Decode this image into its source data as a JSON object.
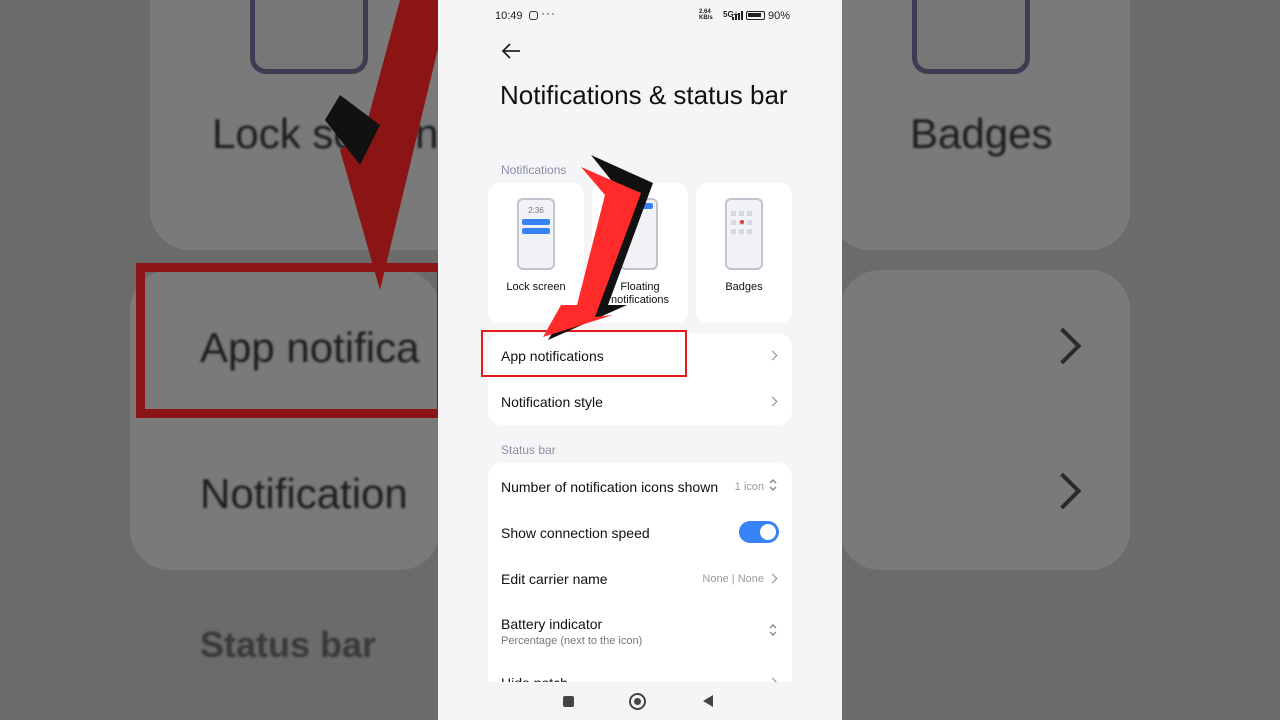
{
  "background": {
    "lock_screen": "Lock screen",
    "badges": "Badges",
    "app_notifications": "App notifica",
    "notification": "Notification",
    "status_bar": "Status bar"
  },
  "statusbar": {
    "time": "10:49",
    "speed_value": "2.64",
    "speed_unit": "KB/s",
    "network": "5G+",
    "battery": "90%"
  },
  "page": {
    "title": "Notifications & status bar",
    "section_notifications": "Notifications",
    "section_status_bar": "Status bar"
  },
  "tiles": [
    {
      "label": "Lock screen",
      "time": "2:36"
    },
    {
      "label": "Floating notifications"
    },
    {
      "label": "Badges"
    }
  ],
  "notification_rows": {
    "app_notifications": "App notifications",
    "notification_style": "Notification style"
  },
  "status_rows": {
    "icons_shown_label": "Number of notification icons shown",
    "icons_shown_value": "1 icon",
    "connection_speed_label": "Show connection speed",
    "connection_speed_on": true,
    "carrier_label": "Edit carrier name",
    "carrier_value": "None | None",
    "battery_label": "Battery indicator",
    "battery_sub": "Percentage (next to the icon)",
    "hide_notch_label": "Hide notch"
  },
  "colors": {
    "accent": "#3a82f7",
    "highlight": "#e41b1b",
    "arrow": "#ff2a2a"
  }
}
